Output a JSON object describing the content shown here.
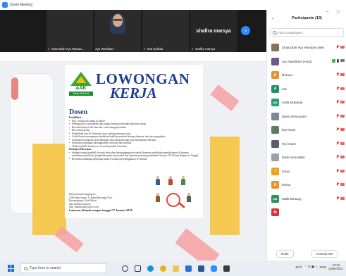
{
  "window": {
    "title": "Zoom Meeting"
  },
  "video_strip": {
    "tiles": [
      {
        "name": "Sinta Diah Ayu Wanda...",
        "muted": true
      },
      {
        "name": "Ayu Wardhani",
        "muted": false
      },
      {
        "name": "Dwi Sulistia",
        "muted": true
      },
      {
        "name": "shafira marsya",
        "display_name": "shafira marsya",
        "muted": true
      }
    ]
  },
  "poster": {
    "logo": {
      "line1": "AAK",
      "line2": "BINA INSANI"
    },
    "headline1": "LOWONGAN",
    "headline2": "KERJA",
    "section_title": "Dosen",
    "kualifikasi_label": "Kualifikasi :",
    "kualifikasi": [
      "Pria / wanita usia maks 45 tahun",
      "Mempunyai jiwa pendidik dan sangat berminat terhadap pekerjaan dosen",
      "Bersedia bekerja full time dan / atau mengajar malam",
      "Bisa bekerjasama",
      "Pendidikan min S2 Akuntansi atau sedang menyusun tesis",
      "Lebih disukai mempunyai tambahan keahlian pendent bidang akuntansi dan atau perpajakan",
      "Senantiasa mengikuti perkembangan ilmu akuntansi dan siap mempelajari hal baru",
      "Senantiasa semangat meningkatkan wawasan dan keahlian",
      "Tidak memiliki komitmen / bersedia pindah homebase"
    ],
    "deskripsi_label": "Deskripsi Pekerjaan :",
    "deskripsi": [
      "Sebagai tenaga pendidik (dosen) anda akan bertanggungjawab untuk akademis melakukan pembelajaran di kampus, melakukan penelitian, pengabdian pada masyarakat dan kegiatan penunjang akademis lainnya (Tri Darma Perguruan Tinggi)",
      "Bersedia melakukan pekerjaan lainnya sesuai penyelenggaraan Tri Darma"
    ],
    "contact_lines": [
      "Kirim lamaran lengkap ke :",
      "AAK Bina Insani, Jl. Raya Siliwangi No 6,",
      "Rawapanjang, Kota Bekasi",
      "atau melalui email ke :",
      "sdm_binainsani@yahoo.com"
    ],
    "deadline": "Lamaran ditunda sampai tanggal 17 Januari 2018"
  },
  "participants_panel": {
    "title": "Participants (19)",
    "search_placeholder": "Find a participant",
    "participants": [
      {
        "name": "Sinta Diah Ayu Wandani (Me)",
        "avatar": "photo",
        "color": "#8a6f5a"
      },
      {
        "name": "Ayu Wardhani (Host)",
        "avatar": "photo",
        "color": "#6a5b8a"
      },
      {
        "name": "khanza",
        "avatar": "K",
        "color": "#e8912d"
      },
      {
        "name": "ami",
        "avatar": "A",
        "color": "#1e8e6e"
      },
      {
        "name": "Aulia Mubarak",
        "avatar": "AM",
        "color": "#26a06b"
      },
      {
        "name": "dewa ahmia putri",
        "avatar": "photo",
        "color": "#7c8a95"
      },
      {
        "name": "faiz khasi",
        "avatar": "photo",
        "color": "#5f7a62"
      },
      {
        "name": "Fari Nami",
        "avatar": "photo",
        "color": "#585e6a"
      },
      {
        "name": "fatah imanuddin",
        "avatar": "photo",
        "color": "#9aa0a6"
      },
      {
        "name": "Ihsan",
        "avatar": "I",
        "color": "#e8a21c"
      },
      {
        "name": "kesha",
        "avatar": "K",
        "color": "#e8912d"
      },
      {
        "name": "Malik Bintang",
        "avatar": "MB",
        "color": "#2e8f5f"
      },
      {
        "name": "",
        "avatar": "M",
        "color": "#d13438"
      }
    ],
    "footer": {
      "invite": "Invite",
      "mute_all": "Unmute Me"
    }
  },
  "taskbar": {
    "search_placeholder": "Type here to search",
    "tray_temp": "30°C",
    "tray_lang": "ENG",
    "clock_time": "10:18",
    "clock_date": "15/06/2021"
  }
}
